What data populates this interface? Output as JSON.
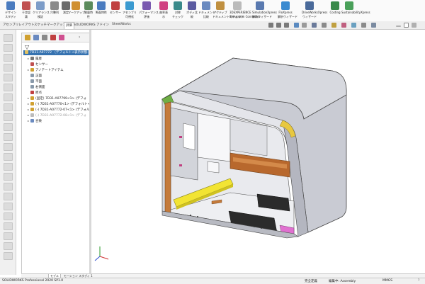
{
  "ribbon": {
    "buttons": [
      {
        "label": "デザイン",
        "sub": "スタディ",
        "color": "#4a7bbf"
      },
      {
        "label": "干渉認",
        "sub": "識",
        "color": "#c05050"
      },
      {
        "label": "クリアランス",
        "sub": "検証",
        "color": "#7c9cc8"
      },
      {
        "label": "穴整列",
        "sub": "",
        "color": "#8a8a8a"
      },
      {
        "label": "測定",
        "sub": "",
        "color": "#6a6a6a"
      },
      {
        "label": "マークアップ",
        "sub": "",
        "color": "#d09030"
      },
      {
        "label": "質量特",
        "sub": "性",
        "color": "#5a8a5a"
      },
      {
        "label": "断面特性",
        "sub": "",
        "color": "#4a7bbf"
      },
      {
        "label": "センサー",
        "sub": "",
        "color": "#c04040"
      },
      {
        "label": "アセンブリ",
        "sub": "可視化",
        "color": "#3a9ad0"
      },
      {
        "label": "パフォーマンス",
        "sub": "評価",
        "color": "#7a5ab0"
      },
      {
        "label": "曲率表",
        "sub": "示",
        "color": "#d04080"
      },
      {
        "label": "対称",
        "sub": "チェック",
        "color": "#3a8a8a"
      },
      {
        "label": "ボディ比",
        "sub": "較",
        "color": "#5a5aa0"
      },
      {
        "label": "ドキュメント",
        "sub": "比較",
        "color": "#6a8ac0"
      },
      {
        "label": "アクティブ",
        "sub": "ドキュメントのチェック",
        "color": "#c09040"
      },
      {
        "label": "3DEXPERIENCE",
        "sub": "Simulation Connector",
        "color": "#bbbbbb"
      },
      {
        "label": "SimulationXpress",
        "sub": "解析ウィザード",
        "color": "#5a7ab0"
      },
      {
        "label": "FloXpress",
        "sub": "解析ウィザード",
        "color": "#3a8ad0"
      },
      {
        "label": "DriveWorksXpress",
        "sub": "ウィザード",
        "color": "#4a6a9a"
      },
      {
        "label": "Costing",
        "sub": "",
        "color": "#3a8a4a"
      },
      {
        "label": "SustainabilityXpress",
        "sub": "",
        "color": "#4aa05a"
      }
    ]
  },
  "command_tabs": [
    {
      "label": "アセンブリ",
      "active": false
    },
    {
      "label": "レイアウト",
      "active": false
    },
    {
      "label": "スケッチ",
      "active": false
    },
    {
      "label": "マークアップ",
      "active": false
    },
    {
      "label": "評価",
      "active": true
    },
    {
      "label": "SOLIDWORKS アドイン",
      "active": false
    },
    {
      "label": "SheetWorks",
      "active": false
    }
  ],
  "tree": {
    "filter_icon": "filter-icon",
    "root": "7D31-A07772 （デフォルト<表示状態-1",
    "items": [
      {
        "label": "履歴",
        "icon": "history-icon",
        "color": "#777777",
        "indent": 1,
        "caret": "▸"
      },
      {
        "label": "センサー",
        "icon": "sensor-icon",
        "color": "#c05050",
        "indent": 1,
        "caret": ""
      },
      {
        "label": "アノテートアイテム",
        "icon": "annotation-icon",
        "color": "#d0a030",
        "indent": 1,
        "caret": "▸"
      },
      {
        "label": "正面",
        "icon": "plane-icon",
        "color": "#8899aa",
        "indent": 1,
        "caret": ""
      },
      {
        "label": "平面",
        "icon": "plane-icon",
        "color": "#8899aa",
        "indent": 1,
        "caret": ""
      },
      {
        "label": "右側面",
        "icon": "plane-icon",
        "color": "#8899aa",
        "indent": 1,
        "caret": ""
      },
      {
        "label": "原点",
        "icon": "origin-icon",
        "color": "#c04040",
        "indent": 1,
        "caret": ""
      },
      {
        "label": "(固定) 7D31-A07799<1> (デフォ",
        "icon": "part-icon",
        "color": "#d0a030",
        "indent": 1,
        "caret": "▸"
      },
      {
        "label": "(-) 7D31-A07770<1> (デフォルト<",
        "icon": "part-icon",
        "color": "#d0a030",
        "indent": 1,
        "caret": "▸"
      },
      {
        "label": "(-) 7D31-A07772-07<1> (デフォルト<",
        "icon": "part-icon",
        "color": "#d0a030",
        "indent": 1,
        "caret": "▸"
      },
      {
        "label": "(-) 7D31-A07772-08<1> (デフォ",
        "icon": "part-icon",
        "color": "#bbbbbb",
        "indent": 1,
        "caret": "▸"
      },
      {
        "label": "合致",
        "icon": "mate-icon",
        "color": "#6a8ac0",
        "indent": 1,
        "caret": "▸"
      }
    ]
  },
  "bottom_tabs": [
    {
      "label": "モデル",
      "active": true
    },
    {
      "label": "モーション スタディ 1",
      "active": false
    }
  ],
  "status": {
    "product": "SOLIDWORKS Professional 2020 SP1.0",
    "state": "完全定義",
    "mode": "編集中: Assembly",
    "units": "MMGS"
  }
}
